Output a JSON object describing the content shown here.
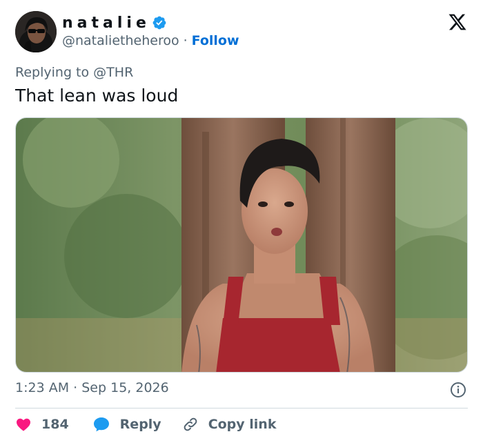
{
  "user": {
    "display_name": "natalie",
    "handle": "@natalietheheroo",
    "separator": "·",
    "follow_label": "Follow"
  },
  "tweet": {
    "replying_prefix": "Replying to",
    "replying_to": "@THR",
    "text": "That lean was loud",
    "time": "1:23 AM",
    "date": "Sep 15, 2026"
  },
  "actions": {
    "like_count": "184",
    "reply_label": "Reply",
    "copy_link_label": "Copy link"
  },
  "colors": {
    "like": "#f91880",
    "reply": "#1d9bf0",
    "follow": "#006fd6",
    "verified": "#1d9bf0",
    "secondary_text": "#536471"
  },
  "icons": [
    "verified-badge-icon",
    "x-logo-icon",
    "info-icon",
    "heart-icon",
    "reply-bubble-icon",
    "link-icon"
  ]
}
